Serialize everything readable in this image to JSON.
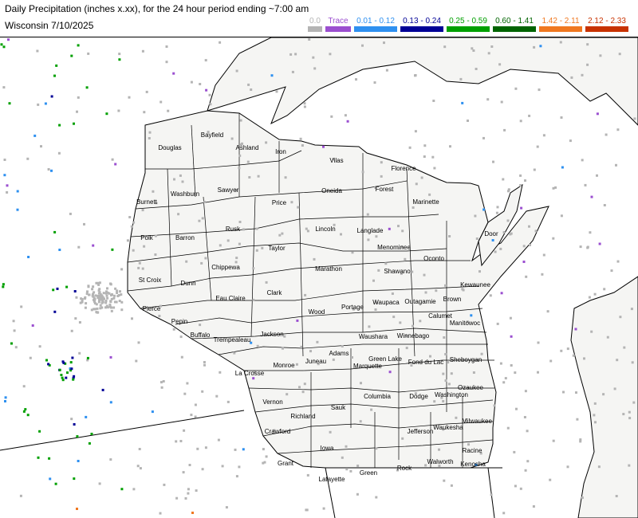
{
  "header": {
    "title": "Daily Precipitation (inches  x.xx),  for the 24 hour period ending ~7:00 am",
    "subtitle": "Wisconsin 7/10/2025"
  },
  "legend": [
    {
      "label": "0.0",
      "color": "#b4b4b4"
    },
    {
      "label": "Trace",
      "color": "#9b4fd0"
    },
    {
      "label": "0.01 - 0.12",
      "color": "#2e90f0"
    },
    {
      "label": "0.13 - 0.24",
      "color": "#000096"
    },
    {
      "label": "0.25 - 0.59",
      "color": "#00a000"
    },
    {
      "label": "0.60 - 1.41",
      "color": "#006400"
    },
    {
      "label": "1.42 - 2.11",
      "color": "#f07820"
    },
    {
      "label": "2.12 - 2.33",
      "color": "#c83200"
    }
  ],
  "counties": [
    "Douglas",
    "Bayfield",
    "Ashland",
    "Iron",
    "Vilas",
    "Florence",
    "Burnett",
    "Washburn",
    "Sawyer",
    "Price",
    "Oneida",
    "Forest",
    "Marinette",
    "Polk",
    "Barron",
    "Rusk",
    "Lincoln",
    "Langlade",
    "Menominee",
    "Oconto",
    "Door",
    "Taylor",
    "St Croix",
    "Dunn",
    "Chippewa",
    "Marathon",
    "Shawano",
    "Kewaunee",
    "Pierce",
    "Eau Claire",
    "Clark",
    "Wood",
    "Portage",
    "Waupaca",
    "Outagamie",
    "Brown",
    "Pepin",
    "Calumet",
    "Manitowoc",
    "Buffalo",
    "Trempealeau",
    "Jackson",
    "Waushara",
    "Winnebago",
    "Monroe",
    "Juneau",
    "Adams",
    "Green Lake",
    "Fond du Lac",
    "Sheboygan",
    "La Crosse",
    "Marquette",
    "Ozaukee",
    "Vernon",
    "Columbia",
    "Dodge",
    "Washington",
    "Richland",
    "Sauk",
    "Crawford",
    "Milwaukee",
    "Jefferson",
    "Waukesha",
    "Grant",
    "Iowa",
    "Racine",
    "Walworth",
    "Kenosha",
    "Lafayette",
    "Green",
    "Rock"
  ]
}
